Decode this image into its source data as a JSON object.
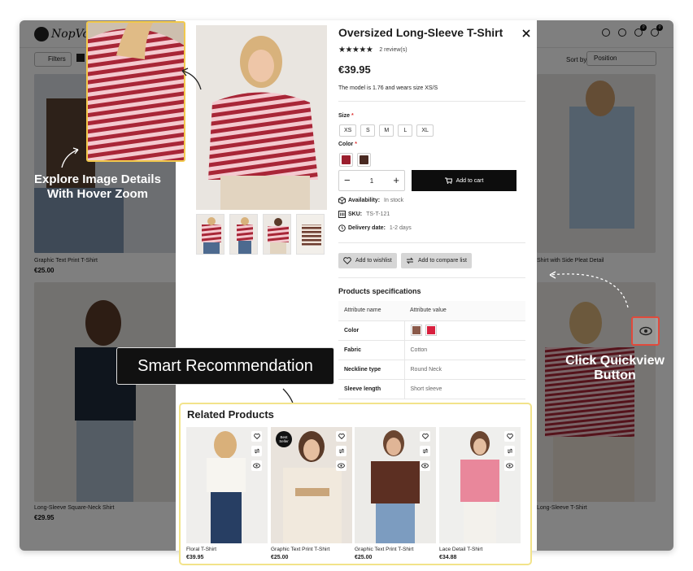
{
  "store": {
    "logo_text": "NopVogue",
    "filters_label": "Filters",
    "sort_label": "Sort by",
    "sort_value": "Position",
    "wishlist_count": "0",
    "cart_count": "0",
    "cards": [
      {
        "name": "Graphic Text Print T-Shirt",
        "price": "€25.00"
      },
      {
        "name": "Long-Sleeve Square-Neck Shirt",
        "price": "€29.95"
      },
      {
        "name": "Shirt with Side Pleat Detail",
        "price": ""
      },
      {
        "name": "Long-Sleeve T-Shirt",
        "price": ""
      }
    ]
  },
  "product": {
    "title": "Oversized Long-Sleeve T-Shirt",
    "stars": "★★★★★",
    "reviews": "2 review(s)",
    "price": "€39.95",
    "model_note": "The model is 1.76 and wears size XS/S",
    "size_label": "Size",
    "required_mark": "*",
    "sizes": [
      "XS",
      "S",
      "M",
      "L",
      "XL"
    ],
    "color_label": "Color",
    "colors": [
      "#9b1f2e",
      "#4a2a22"
    ],
    "qty_minus": "−",
    "quantity": "1",
    "qty_plus": "+",
    "add_to_cart": "Add to cart",
    "availability_label": "Availability:",
    "availability_value": "In stock",
    "sku_label": "SKU:",
    "sku_value": "TS-T-121",
    "delivery_label": "Delivery date:",
    "delivery_value": "1-2 days",
    "wishlist_btn": "Add to wishlist",
    "compare_btn": "Add to compare list",
    "specs_title": "Products specifications",
    "specs_headers": [
      "Attribute name",
      "Attribute value"
    ],
    "specs": [
      {
        "name": "Color",
        "value": ""
      },
      {
        "name": "Fabric",
        "value": "Cotton"
      },
      {
        "name": "Neckline type",
        "value": "Round Neck"
      },
      {
        "name": "Sleeve length",
        "value": "Short sleeve"
      }
    ],
    "spec_colors": [
      "#8b5a4a",
      "#d8203e"
    ]
  },
  "annotations": {
    "zoom_line1": "Explore Image Details",
    "zoom_line2": "With Hover Zoom",
    "smart": "Smart Recommendation",
    "quickview_line1": "Click Quickview",
    "quickview_line2": "Button"
  },
  "related": {
    "title": "Related Products",
    "badge": "Best Seller",
    "items": [
      {
        "name": "Floral T-Shirt",
        "price": "€39.95"
      },
      {
        "name": "Graphic Text Print T-Shirt",
        "price": "€25.00"
      },
      {
        "name": "Graphic Text Print T-Shirt",
        "price": "€25.00"
      },
      {
        "name": "Lace Detail T-Shirt",
        "price": "€34.88"
      }
    ]
  },
  "colors": {
    "accent_yellow": "#f2c94c",
    "highlight_red": "#e04a3c",
    "stripe_red": "#a82637",
    "stripe_pink": "#f4c9cf"
  }
}
